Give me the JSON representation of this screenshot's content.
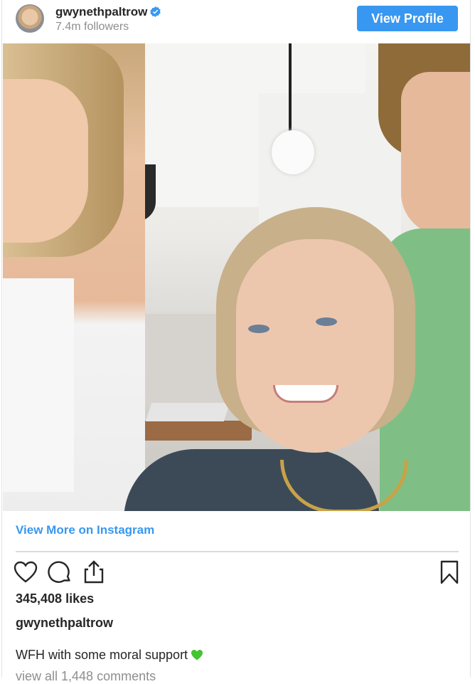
{
  "header": {
    "username": "gwynethpaltrow",
    "followers": "7.4m followers",
    "view_profile_label": "View Profile"
  },
  "post": {
    "view_more_label": "View More on Instagram",
    "likes": "345,408 likes",
    "caption_user": "gwynethpaltrow",
    "caption_text": "WFH with some moral support",
    "view_comments": "view all 1,448 comments"
  },
  "icons": {
    "verified": "verified-badge-icon",
    "like": "heart-outline-icon",
    "comment": "comment-bubble-icon",
    "share": "share-upload-icon",
    "save": "bookmark-icon",
    "emoji": "green-heart-emoji"
  },
  "colors": {
    "accent": "#3897f0",
    "text": "#262626",
    "muted": "#8e8e8e",
    "divider": "#dbdbdb"
  }
}
